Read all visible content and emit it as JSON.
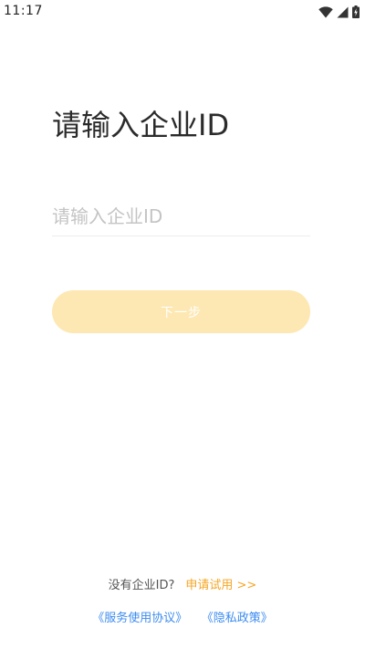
{
  "status_bar": {
    "time": "11:17",
    "icons": [
      "wifi-icon",
      "cell-signal-icon",
      "battery-icon"
    ]
  },
  "login": {
    "title": "请输入企业ID",
    "input_placeholder": "请输入企业ID",
    "input_value": "",
    "next_button_label": "下一步"
  },
  "footer": {
    "no_id_prompt": "没有企业ID?",
    "trial_link": "申请试用 >>",
    "terms_link": "《服务使用协议》",
    "privacy_link": "《隐私政策》"
  },
  "colors": {
    "accent": "#f5a623",
    "button_disabled": "#fde8b4",
    "link": "#3d8cf0",
    "title": "#2b2b2b",
    "placeholder": "#c4c4c4"
  }
}
